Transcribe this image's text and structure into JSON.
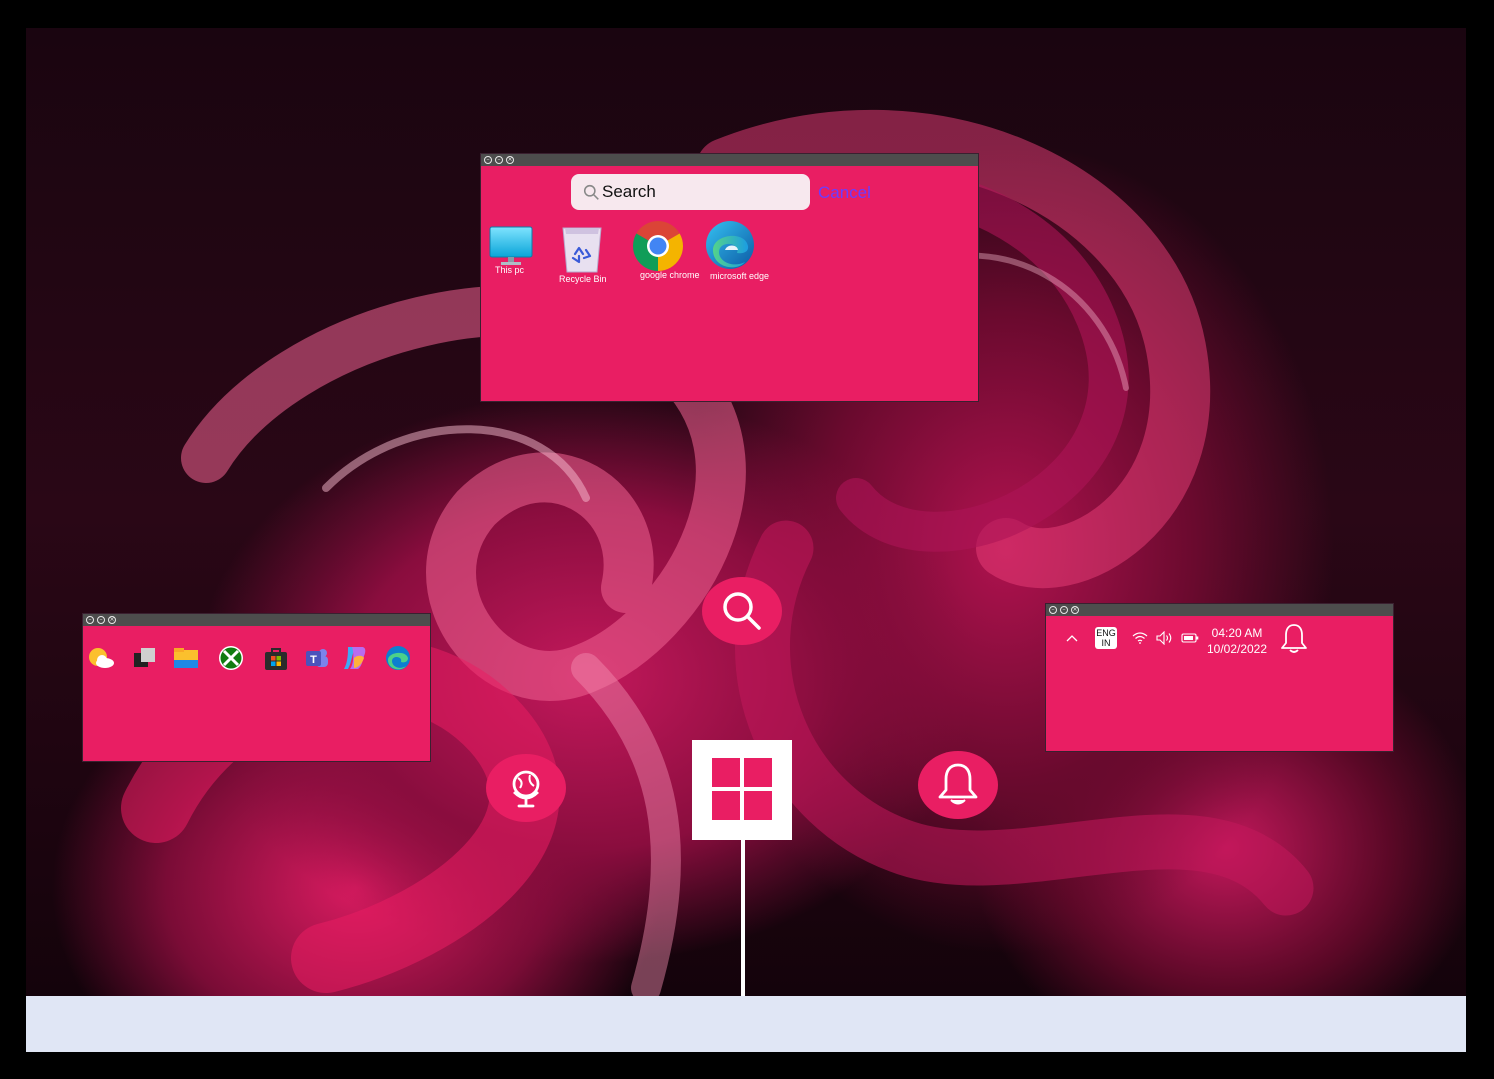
{
  "search_window": {
    "search": {
      "placeholder": "Search",
      "cancel_label": "Cancel"
    },
    "desktop_icons": [
      {
        "label": "This pc",
        "icon": "monitor-icon"
      },
      {
        "label": "Recycle Bin",
        "icon": "recycle-bin-icon"
      },
      {
        "label": "google chrome",
        "icon": "chrome-icon"
      },
      {
        "label": "microsoft edge",
        "icon": "edge-icon"
      }
    ]
  },
  "pinned_apps": [
    "weather-icon",
    "task-view-icon",
    "file-explorer-icon",
    "xbox-icon",
    "microsoft-store-icon",
    "teams-icon",
    "copilot-icon",
    "edge-icon"
  ],
  "tray": {
    "language_line1": "ENG",
    "language_line2": "IN",
    "time": "04:20 AM",
    "date": "10/02/2022"
  },
  "colors": {
    "accent": "#e91e63",
    "taskbar": "#e0e6f5",
    "titlebar": "#4d4d4d",
    "cancel": "#6b3cff"
  }
}
